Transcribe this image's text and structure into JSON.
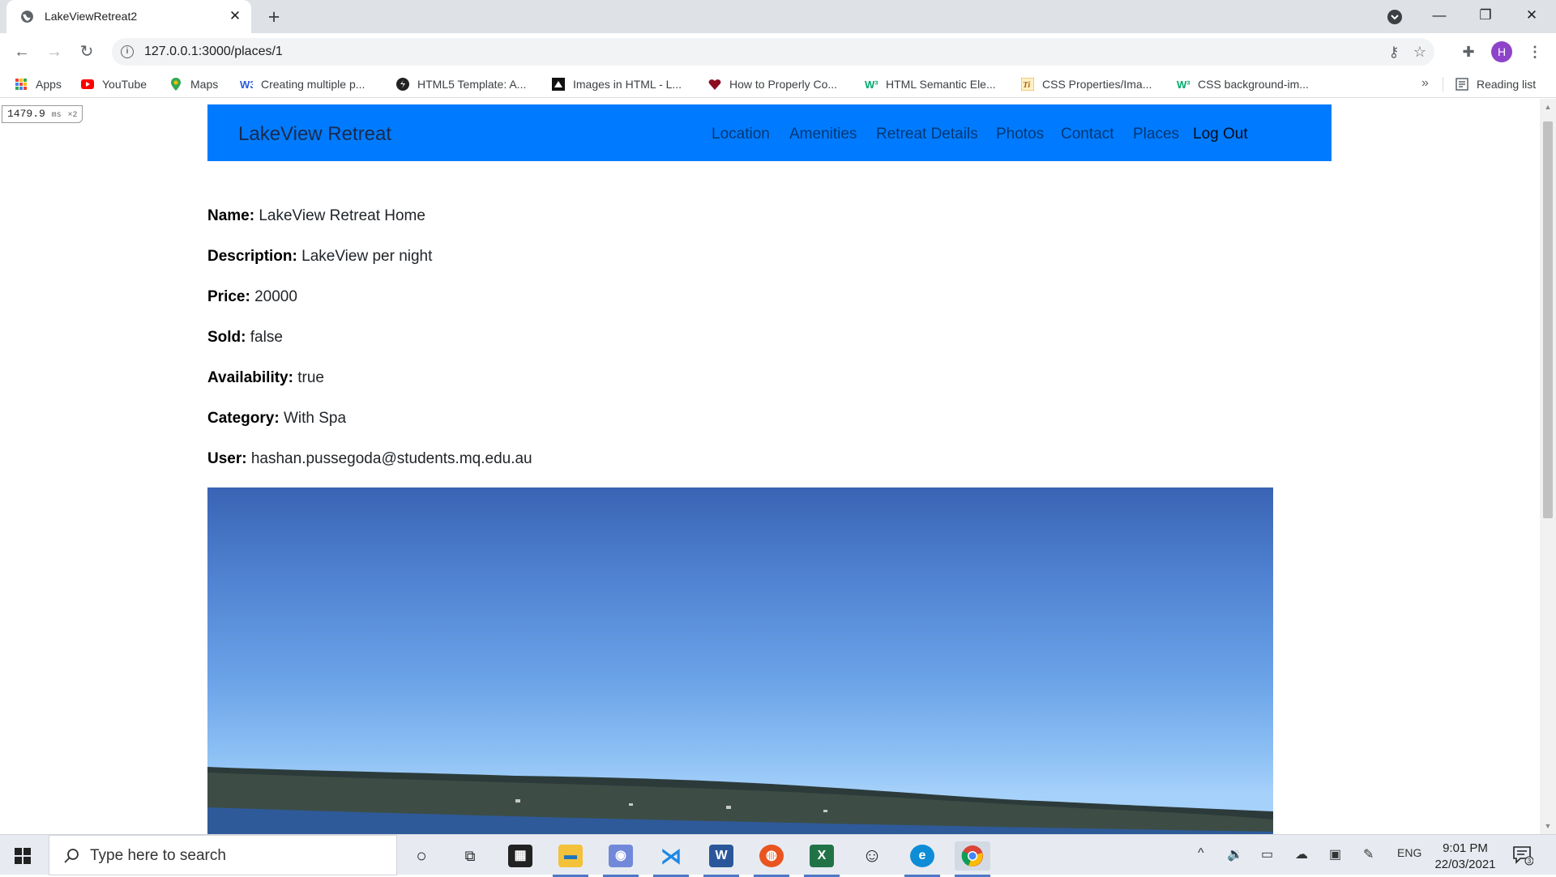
{
  "browser": {
    "tab_title": "LakeViewRetreat2",
    "tab_close": "✕",
    "new_tab": "+",
    "url": "127.0.0.1:3000/places/1",
    "profile_initial": "H",
    "bookmarks": [
      {
        "label": "Apps",
        "icon": "apps-grid-icon"
      },
      {
        "label": "YouTube",
        "icon": "youtube-icon"
      },
      {
        "label": "Maps",
        "icon": "maps-pin-icon"
      },
      {
        "label": "Creating multiple p...",
        "icon": "w3schools-icon"
      },
      {
        "label": "HTML5 Template: A...",
        "icon": "sitepoint-icon"
      },
      {
        "label": "Images in HTML - L...",
        "icon": "mdn-icon"
      },
      {
        "label": "How to Properly Co...",
        "icon": "heart-icon"
      },
      {
        "label": "HTML Semantic Ele...",
        "icon": "w3-green-icon"
      },
      {
        "label": "CSS Properties/Ima...",
        "icon": "tutorialspoint-icon"
      },
      {
        "label": "CSS background-im...",
        "icon": "w3-green-icon"
      }
    ],
    "bookmarks_more": "»",
    "reading_list": "Reading list",
    "colors": {
      "tabstrip": "#dee1e6",
      "avatar": "#8e44c9"
    }
  },
  "perf": {
    "value": "1479.9",
    "unit": "ms",
    "multiplier": "×2"
  },
  "site": {
    "brand": "LakeView Retreat",
    "nav": [
      "Location",
      "Amenities",
      "Retreat Details",
      "Photos",
      "Contact",
      "Places",
      "Log Out"
    ],
    "nav_color": "#007bff"
  },
  "place": {
    "fields": [
      {
        "label": "Name:",
        "value": "LakeView Retreat Home"
      },
      {
        "label": "Description:",
        "value": "LakeView per night"
      },
      {
        "label": "Price:",
        "value": "20000"
      },
      {
        "label": "Sold:",
        "value": "false"
      },
      {
        "label": "Availability:",
        "value": "true"
      },
      {
        "label": "Category:",
        "value": "With Spa"
      },
      {
        "label": "User:",
        "value": "hashan.pussegoda@students.mq.edu.au"
      }
    ]
  },
  "taskbar": {
    "search_placeholder": "Type here to search",
    "language": "ENG",
    "time": "9:01 PM",
    "date": "22/03/2021",
    "notification_count": "3",
    "apps": [
      "cortana-icon",
      "task-view-icon",
      "store-icon",
      "file-explorer-icon",
      "discord-icon",
      "vscode-icon",
      "word-icon",
      "ubuntu-icon",
      "excel-icon",
      "emoji-app-icon",
      "edge-icon",
      "chrome-icon"
    ]
  }
}
